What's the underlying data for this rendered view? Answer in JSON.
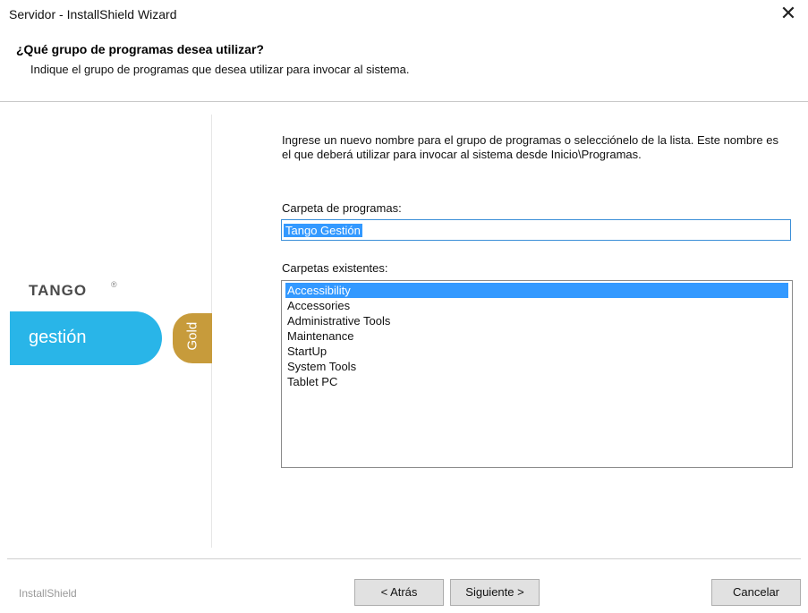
{
  "window": {
    "title": "Servidor - InstallShield Wizard",
    "close_glyph": "✕"
  },
  "header": {
    "title": "¿Qué grupo de programas desea utilizar?",
    "subtitle": "Indique el grupo de programas que desea utilizar para invocar al sistema."
  },
  "branding": {
    "logo": "TANGO",
    "logo_mark": "®",
    "product": "gestión",
    "edition": "Gold",
    "footer": "InstallShield",
    "colors": {
      "gestion": "#29b5e8",
      "gold": "#c79b3b"
    }
  },
  "main": {
    "instructions": "Ingrese un nuevo nombre para el grupo de programas o selecciónelo de la lista. Este nombre es el que deberá utilizar para invocar al sistema desde Inicio\\Programas.",
    "folder_label": "Carpeta de programas:",
    "folder_value": "Tango Gestión",
    "existing_label": "Carpetas existentes:",
    "existing_folders": [
      "Accessibility",
      "Accessories",
      "Administrative Tools",
      "Maintenance",
      "StartUp",
      "System Tools",
      "Tablet PC"
    ],
    "selected_folder": "Accessibility"
  },
  "buttons": {
    "back": "< Atrás",
    "next": "Siguiente >",
    "cancel": "Cancelar"
  }
}
